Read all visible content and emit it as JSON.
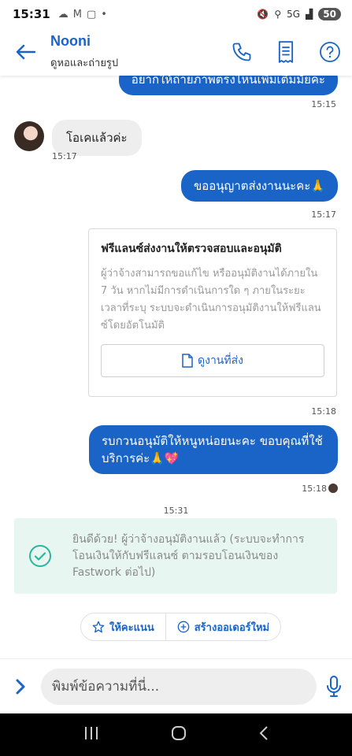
{
  "status_bar": {
    "time": "15:31",
    "network": "5G",
    "battery": "50"
  },
  "header": {
    "name": "Nooni",
    "subtitle": "ดูหอและถ่ายรูป"
  },
  "messages": {
    "m0_text": "อยากให้ถ่ายภาพตรงไหนเพิ่มเติมมั้ยคะ",
    "m0_time": "15:15",
    "m1_text": "โอเคแล้วค่ะ",
    "m1_time": "15:17",
    "m2_text": "ขออนุญาตส่งงานนะคะ🙏",
    "m2_time": "15:17",
    "card_title": "ฟรีแลนซ์ส่งงานให้ตรวจสอบและอนุมัติ",
    "card_body": "ผู้ว่าจ้างสามารถขอแก้ไข หรืออนุมัติงานได้ภายใน 7 วัน หากไม่มีการดำเนินการใด ๆ ภายในระยะเวลาที่ระบุ ระบบจะดำเนินการอนุมัติงานให้ฟรีแลนซ์โดยอัตโนมัติ",
    "card_button": "ดูงานที่ส่ง",
    "card_time": "15:18",
    "m3_text": "รบกวนอนุมัติให้หนูหน่อยนะคะ ขอบคุณที่ใช้บริการค่ะ🙏💖",
    "m3_time": "15:18"
  },
  "divider_time": "15:31",
  "notice": {
    "text": "ยินดีด้วย! ผู้ว่าจ้างอนุมัติงานแล้ว (ระบบจะทำการโอนเงินให้กับฟรีแลนซ์ ตามรอบโอนเงินของ Fastwork ต่อไป)"
  },
  "actions": {
    "rate": "ให้คะแนน",
    "new_order": "สร้างออเดอร์ใหม่"
  },
  "input": {
    "placeholder": "พิมพ์ข้อความที่นี่..."
  },
  "colors": {
    "accent": "#1a64c8",
    "success": "#2bb59a",
    "notice_bg": "#e8f6f2"
  }
}
